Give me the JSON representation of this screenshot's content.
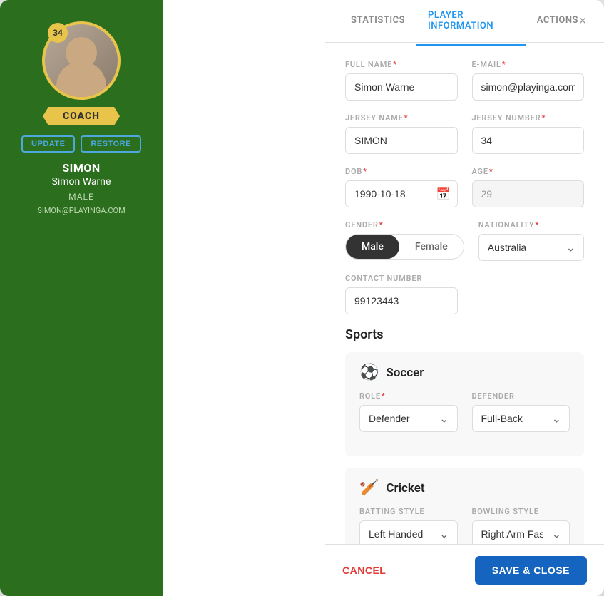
{
  "sidebar": {
    "badge_number": "34",
    "role_label": "COACH",
    "update_btn": "UPDATE",
    "restore_btn": "RESTORE",
    "username": "SIMON",
    "full_name": "Simon Warne",
    "gender": "MALE",
    "email": "SIMON@PLAYINGA.COM"
  },
  "tabs": [
    {
      "id": "statistics",
      "label": "STATISTICS"
    },
    {
      "id": "player-information",
      "label": "PLAYER INFORMATION"
    },
    {
      "id": "actions",
      "label": "ACTIONS"
    }
  ],
  "close_label": "×",
  "form": {
    "full_name_label": "FULL NAME",
    "full_name_value": "Simon Warne",
    "email_label": "E-MAIL",
    "email_value": "simon@playinga.com",
    "jersey_name_label": "JERSEY NAME",
    "jersey_name_value": "SIMON",
    "jersey_number_label": "JERSEY NUMBER",
    "jersey_number_value": "34",
    "dob_label": "DOB",
    "dob_value": "1990-10-18",
    "age_label": "AGE",
    "age_value": "29",
    "gender_label": "GENDER",
    "gender_male": "Male",
    "gender_female": "Female",
    "nationality_label": "NATIONALITY",
    "nationality_value": "Australia",
    "contact_label": "CONTACT NUMBER",
    "contact_value": "99123443"
  },
  "sports_section_title": "Sports",
  "soccer": {
    "name": "Soccer",
    "icon": "⚽",
    "role_label": "ROLE",
    "role_value": "Defender",
    "position_label": "DEFENDER",
    "position_value": "Full-Back"
  },
  "cricket": {
    "name": "Cricket",
    "icon": "🏏",
    "batting_label": "BATTING STYLE",
    "batting_value": "Left Handed",
    "bowling_label": "BOWLING STYLE",
    "bowling_value": "Right Arm Fast..."
  },
  "footer": {
    "cancel_label": "CANCEL",
    "save_close_label": "SAVE & CLOSE"
  }
}
